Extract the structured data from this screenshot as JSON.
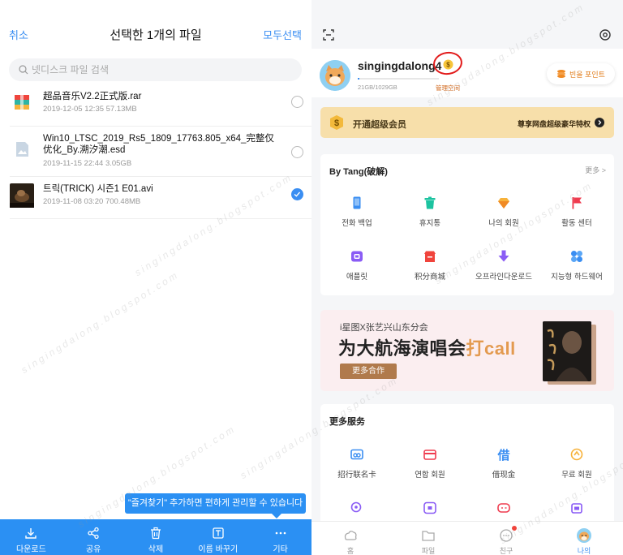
{
  "left": {
    "header": {
      "cancel": "취소",
      "title": "선택한 1개의 파일",
      "select_all": "모두선택"
    },
    "search": {
      "placeholder": "넷디스크 파일 검색"
    },
    "files": [
      {
        "name": "超品音乐V2.2正式版.rar",
        "meta": "2019-12-05  12:35   57.13MB",
        "selected": false
      },
      {
        "name": "Win10_LTSC_2019_Rs5_1809_17763.805_x64_完整仅优化_By.溯汐潮.esd",
        "meta": "2019-11-15  22:44   3.05GB",
        "selected": false
      },
      {
        "name": "트릭(TRICK) 시즌1 E01.avi",
        "meta": "2019-11-08  03:20   700.48MB",
        "selected": true
      }
    ],
    "tooltip": "\"즐겨찾기\" 추가하면 편하게 관리할 수 있습니다",
    "toolbar": [
      {
        "label": "다운로드",
        "icon": "download-icon"
      },
      {
        "label": "공유",
        "icon": "share-icon"
      },
      {
        "label": "삭제",
        "icon": "trash-icon"
      },
      {
        "label": "이름 바꾸기",
        "icon": "rename-icon"
      },
      {
        "label": "기타",
        "icon": "more-icon"
      }
    ]
  },
  "right": {
    "profile": {
      "username": "singingdalong4",
      "storage": "21GB/1029GB",
      "storage_used_fraction": 0.02,
      "manage": "管理空间",
      "points": "빈을 포인트"
    },
    "vip": {
      "title": "开通超级会员",
      "right": "尊享网盘超级豪华特权"
    },
    "tools": {
      "title": "By Tang(破解)",
      "more": "更多 >",
      "items": [
        {
          "label": "전화 백업",
          "icon": "phone-backup-icon",
          "color": "#3a8ef2"
        },
        {
          "label": "휴지통",
          "icon": "trash-bin-icon",
          "color": "#1cc3a0"
        },
        {
          "label": "나의 회원",
          "icon": "diamond-icon",
          "color": "#f7b23b"
        },
        {
          "label": "활동 센터",
          "icon": "flag-icon",
          "color": "#ef3b4f"
        },
        {
          "label": "애플릿",
          "icon": "applet-icon",
          "color": "#8a5cf5"
        },
        {
          "label": "积分商城",
          "icon": "shop-icon",
          "color": "#f0443c"
        },
        {
          "label": "오프라인다운로드",
          "icon": "offline-download-icon",
          "color": "#8a5cf5"
        },
        {
          "label": "지능형 하드웨어",
          "icon": "hardware-icon",
          "color": "#3a8ef2"
        }
      ]
    },
    "promo": {
      "subtitle": "i星图X张艺兴山东分会",
      "title_main": "为大航海演唱会",
      "title_accent": "打call",
      "button": "更多合作"
    },
    "services": {
      "title": "更多服务",
      "items": [
        {
          "label": "招行联名卡",
          "icon": "card-icon",
          "color": "#3a8ef2"
        },
        {
          "label": "연합 회원",
          "icon": "member-card-icon",
          "color": "#ef3b4f"
        },
        {
          "label": "借现金",
          "icon": "cash-icon",
          "color": "#3a8ef2"
        },
        {
          "label": "무료 회원",
          "icon": "free-member-icon",
          "color": "#f7b23b"
        }
      ]
    },
    "tabs": [
      {
        "label": "홈",
        "icon": "home-tab-icon",
        "active": false
      },
      {
        "label": "파일",
        "icon": "file-tab-icon",
        "active": false
      },
      {
        "label": "친구",
        "icon": "chat-tab-icon",
        "active": false,
        "badge": true
      },
      {
        "label": "나의",
        "icon": "me-tab-icon",
        "active": true
      }
    ]
  },
  "watermark": "singingdalong.blogspot.com"
}
